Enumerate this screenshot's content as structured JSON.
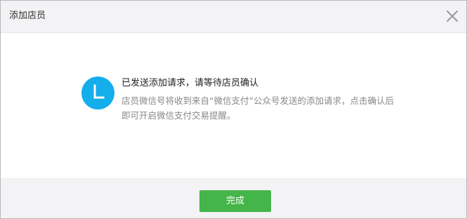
{
  "dialog": {
    "title": "添加店员",
    "close_icon": "close-icon"
  },
  "message": {
    "status_icon": "clock-icon",
    "title": "已发送添加请求，请等待店员确认",
    "description": "店员微信号将收到来自“微信支付”公众号发送的添加请求，点击确认后即可开启微信支付交易提醒。"
  },
  "footer": {
    "done_label": "完成"
  },
  "colors": {
    "accent_green": "#44b549",
    "icon_blue": "#14aeea",
    "header_bg": "#f3f3f5"
  }
}
